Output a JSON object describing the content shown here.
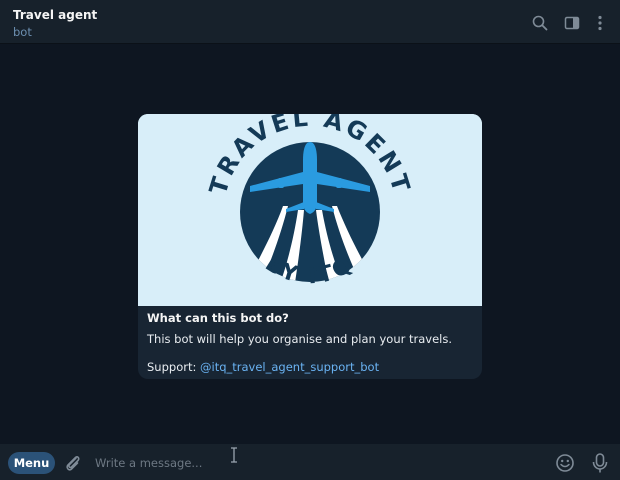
{
  "header": {
    "title": "Travel agent",
    "subtitle": "bot",
    "icons": [
      "search-icon",
      "sidebar-toggle-icon",
      "more-vertical-icon"
    ]
  },
  "card": {
    "logo": {
      "top_text": "TRAVEL AGENT",
      "bottom_text": "BY ITQ",
      "colors": {
        "background": "#d8eef9",
        "navy": "#143a57",
        "plane": "#2a9be0"
      }
    },
    "heading": "What can this bot do?",
    "description": "This bot will help you organise and plan your travels.",
    "support_prefix": "Support: ",
    "support_handle": "@itq_travel_agent_support_bot"
  },
  "composer": {
    "menu_label": "Menu",
    "placeholder": "Write a message...",
    "icons": [
      "attach-icon",
      "emoji-icon",
      "microphone-icon"
    ]
  },
  "colors": {
    "chat_background": "#0e1621",
    "panel": "#17212b",
    "card": "#182533",
    "accent": "#6ab3f3",
    "menu_button": "#2b5278"
  }
}
